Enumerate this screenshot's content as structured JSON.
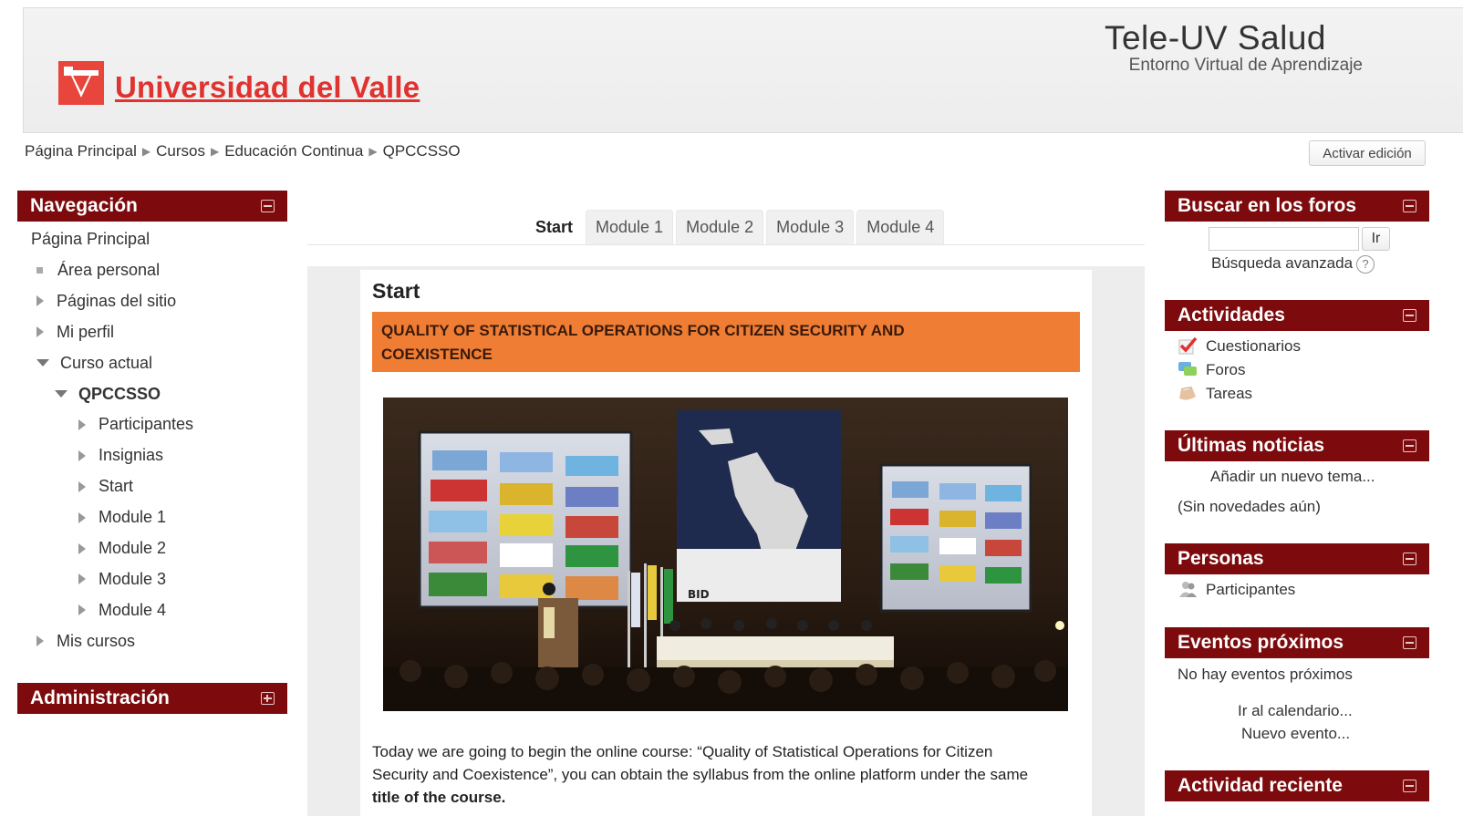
{
  "header": {
    "university": "Universidad del Valle",
    "site_title": "Tele-UV Salud",
    "site_subtitle": "Entorno Virtual de Aprendizaje"
  },
  "breadcrumb": [
    "Página Principal",
    "Cursos",
    "Educación Continua",
    "QPCCSSO"
  ],
  "edit_button": "Activar edición",
  "navigation": {
    "title": "Navegación",
    "items": [
      {
        "label": "Página Principal",
        "level": 0,
        "marker": "none"
      },
      {
        "label": "Área personal",
        "level": 1,
        "marker": "bullet"
      },
      {
        "label": "Páginas del sitio",
        "level": 1,
        "marker": "collapsed"
      },
      {
        "label": "Mi perfil",
        "level": 1,
        "marker": "collapsed"
      },
      {
        "label": "Curso actual",
        "level": 1,
        "marker": "expanded"
      },
      {
        "label": "QPCCSSO",
        "level": 2,
        "marker": "expanded",
        "bold": true
      },
      {
        "label": "Participantes",
        "level": 3,
        "marker": "collapsed"
      },
      {
        "label": "Insignias",
        "level": 3,
        "marker": "collapsed"
      },
      {
        "label": "Start",
        "level": 3,
        "marker": "collapsed"
      },
      {
        "label": "Module 1",
        "level": 3,
        "marker": "collapsed"
      },
      {
        "label": "Module 2",
        "level": 3,
        "marker": "collapsed"
      },
      {
        "label": "Module 3",
        "level": 3,
        "marker": "collapsed"
      },
      {
        "label": "Module 4",
        "level": 3,
        "marker": "collapsed"
      },
      {
        "label": "Mis cursos",
        "level": 1,
        "marker": "collapsed"
      }
    ]
  },
  "administration": {
    "title": "Administración"
  },
  "tabs": [
    {
      "label": "Start",
      "active": true
    },
    {
      "label": "Module 1",
      "active": false
    },
    {
      "label": "Module 2",
      "active": false
    },
    {
      "label": "Module 3",
      "active": false
    },
    {
      "label": "Module 4",
      "active": false
    }
  ],
  "content": {
    "section_title": "Start",
    "banner_line1": "QUALITY OF STATISTICAL OPERATIONS FOR CITIZEN SECURITY AND",
    "banner_line2": "COEXISTENCE",
    "photo_caption_text": "BID",
    "intro_line1": "Today we are going to begin the online course: “Quality of Statistical Operations for Citizen",
    "intro_line2": "Security and Coexistence”, you can obtain the syllabus from the online platform under the same",
    "intro_line3_bold": "title of the course."
  },
  "blocks": {
    "search": {
      "title": "Buscar en los foros",
      "go_label": "Ir",
      "advanced": "Búsqueda avanzada",
      "help": "?"
    },
    "activities": {
      "title": "Actividades",
      "items": [
        "Cuestionarios",
        "Foros",
        "Tareas"
      ]
    },
    "news": {
      "title": "Últimas noticias",
      "add": "Añadir un nuevo tema...",
      "empty": "(Sin novedades aún)"
    },
    "people": {
      "title": "Personas",
      "item": "Participantes"
    },
    "events": {
      "title": "Eventos próximos",
      "empty": "No hay eventos próximos",
      "calendar": "Ir al calendario...",
      "new": "Nuevo evento..."
    },
    "recent": {
      "title": "Actividad reciente"
    }
  },
  "colors": {
    "block_header": "#7d0a0c",
    "banner": "#ef7d34",
    "brand_red": "#e0322e"
  }
}
